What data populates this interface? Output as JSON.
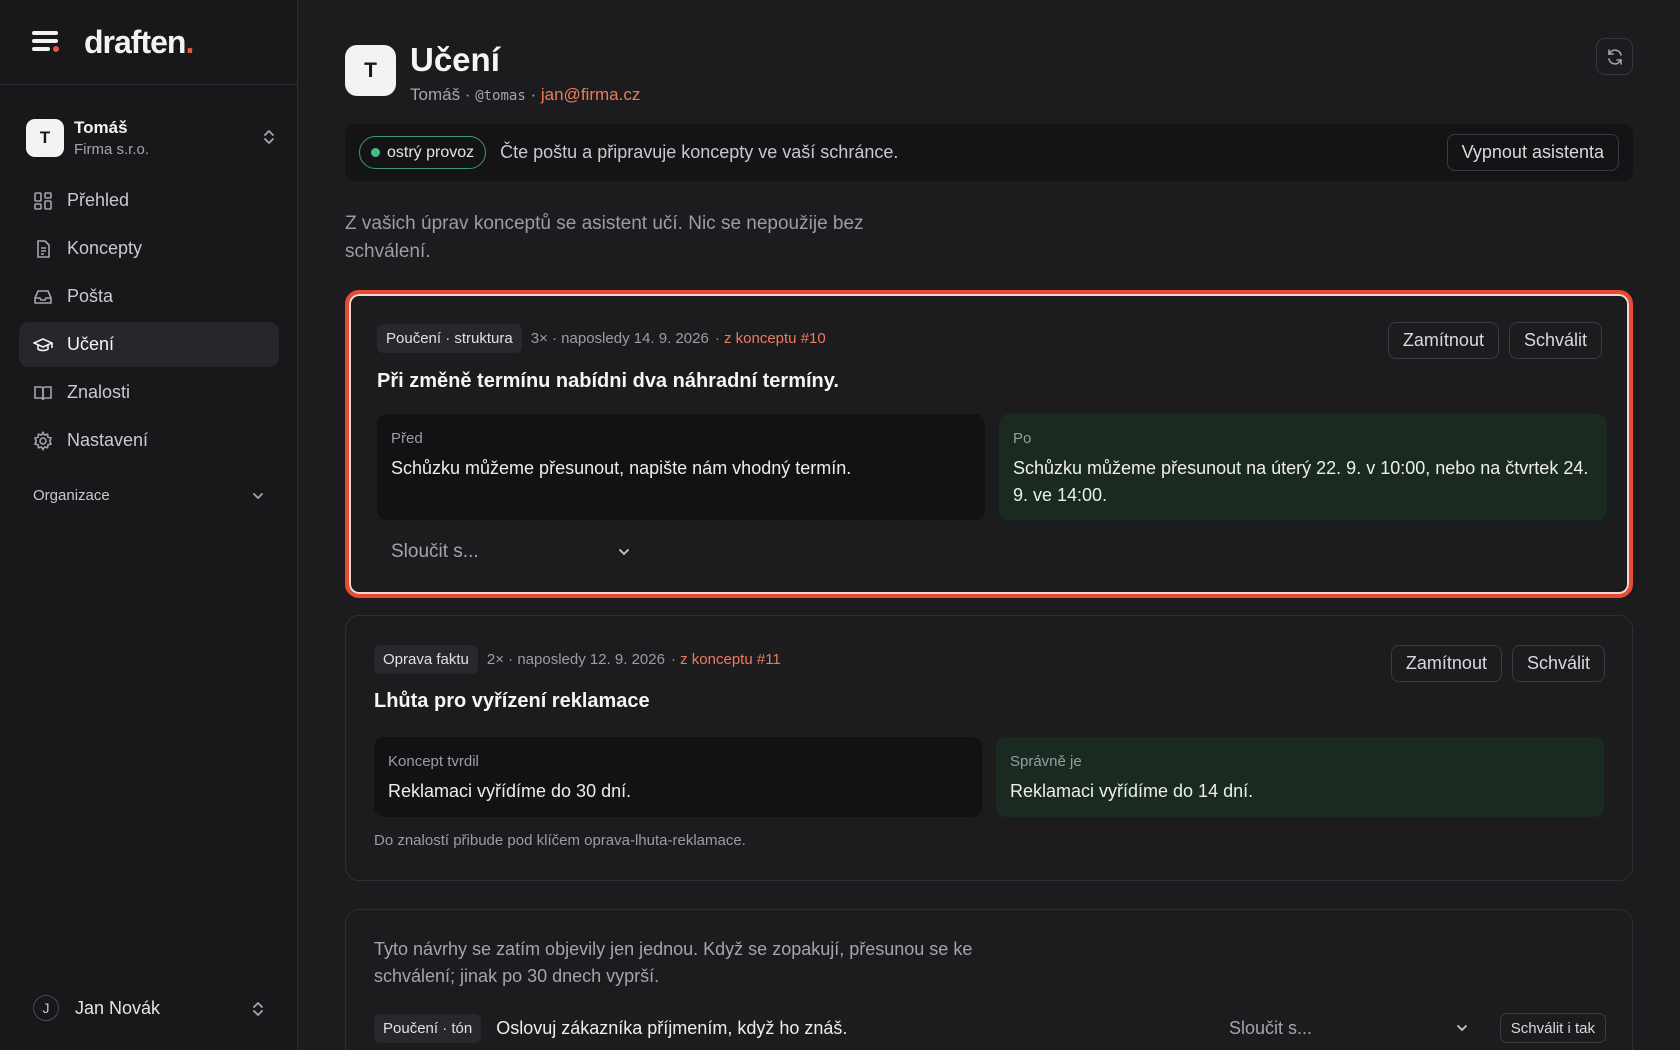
{
  "brand": {
    "name": "draften",
    "dot": "."
  },
  "org": {
    "avatar": "T",
    "name": "Tomáš",
    "sub": "Firma s.r.o."
  },
  "nav": [
    {
      "label": "Přehled",
      "icon": "grid-icon"
    },
    {
      "label": "Koncepty",
      "icon": "document-icon"
    },
    {
      "label": "Pošta",
      "icon": "inbox-icon"
    },
    {
      "label": "Učení",
      "icon": "graduation-cap-icon"
    },
    {
      "label": "Znalosti",
      "icon": "book-icon"
    },
    {
      "label": "Nastavení",
      "icon": "gear-icon"
    }
  ],
  "nav_section": "Organizace",
  "user": {
    "avatar": "J",
    "name": "Jan Novák"
  },
  "header": {
    "avatar": "T",
    "title": "Učení",
    "name": "Tomáš",
    "sep1": " · ",
    "handle": "@tomas",
    "sep2": " · ",
    "email": "jan@firma.cz"
  },
  "status": {
    "badge": "ostrý provoz",
    "text": "Čte poštu a připravuje koncepty ve vaší schránce.",
    "button": "Vypnout asistenta"
  },
  "intro": "Z vašich úprav konceptů se asistent učí. Nic se nepoužije bez schválení.",
  "cards": [
    {
      "tag": "Poučení · struktura",
      "count": "3×",
      "last": "· naposledy 14. 9. 2026",
      "source": "· z konceptu #10",
      "title": "Při změně termínu nabídni dva náhradní termíny.",
      "reject": "Zamítnout",
      "approve": "Schválit",
      "before_label": "Před",
      "before_text": "Schůzku můžeme přesunout, napište nám vhodný termín.",
      "after_label": "Po",
      "after_text": "Schůzku můžeme přesunout na úterý 22. 9. v 10:00, nebo na čtvrtek 24. 9. ve 14:00.",
      "merge": "Sloučit s..."
    },
    {
      "tag": "Oprava faktu",
      "count": "2×",
      "last": "· naposledy 12. 9. 2026",
      "source": "· z konceptu #11",
      "title": "Lhůta pro vyřízení reklamace",
      "reject": "Zamítnout",
      "approve": "Schválit",
      "before_label": "Koncept tvrdil",
      "before_text": "Reklamaci vyřídíme do 30 dní.",
      "after_label": "Správně je",
      "after_text": "Reklamaci vyřídíme do 14 dní.",
      "note": "Do znalostí přibude pod klíčem oprava-lhuta-reklamace."
    }
  ],
  "pending": {
    "text": "Tyto návrhy se zatím objevily jen jednou. Když se zopakují, přesunou se ke schválení; jinak po 30 dnech vyprší.",
    "tag": "Poučení · tón",
    "lesson": "Oslovuj zákazníka příjmením, když ho znáš.",
    "merge": "Sloučit s...",
    "approve_anyway": "Schválit i tak"
  }
}
